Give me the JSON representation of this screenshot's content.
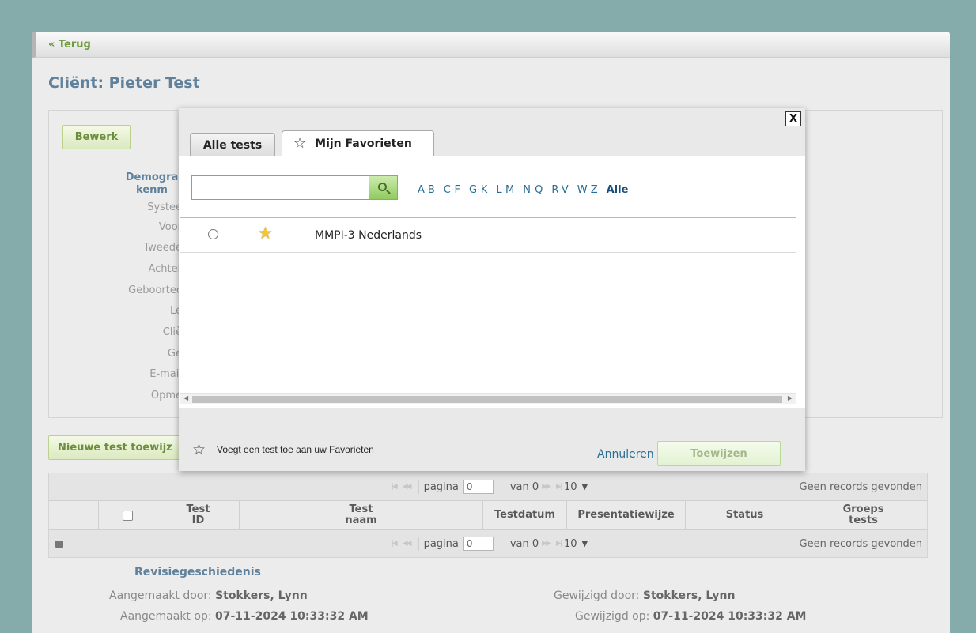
{
  "nav": {
    "back_label": "« Terug"
  },
  "client": {
    "title": "Cliënt: Pieter Test"
  },
  "panel": {
    "edit_label": "Bewerk",
    "demographics_heading": "Demogra\nkenm",
    "field_labels": [
      "Systee",
      "Voor",
      "Tweede",
      "Achter",
      "Geboortec",
      "Le",
      "Cliè",
      "Ge",
      "E-mail",
      "Opme"
    ]
  },
  "assign": {
    "new_test_label": "Nieuwe test toewijz"
  },
  "grid": {
    "pager": {
      "page_label": "pagina",
      "page_value": "0",
      "of_label": "van 0",
      "rows_per_page": "10",
      "no_records": "Geen records gevonden"
    },
    "columns": [
      "Test\nID",
      "Test\nnaam",
      "Testdatum",
      "Presentatiewijze",
      "Status",
      "Groeps\ntests"
    ]
  },
  "revision": {
    "title": "Revisiegeschiedenis",
    "created_by_label": "Aangemaakt door:",
    "created_by": "Stokkers, Lynn",
    "created_on_label": "Aangemaakt op:",
    "created_on": "07-11-2024 10:33:32 AM",
    "modified_by_label": "Gewijzigd door:",
    "modified_by": "Stokkers, Lynn",
    "modified_on_label": "Gewijzigd op:",
    "modified_on": "07-11-2024 10:33:32 AM"
  },
  "modal": {
    "close_label": "X",
    "tabs": {
      "all": "Alle tests",
      "favorites": "Mijn Favorieten"
    },
    "search": {
      "value": "",
      "placeholder": ""
    },
    "alpha_filters": [
      "A-B",
      "C-F",
      "G-K",
      "L-M",
      "N-Q",
      "R-V",
      "W-Z",
      "Alle"
    ],
    "active_filter": "Alle",
    "tests": [
      {
        "name": "MMPI-3 Nederlands",
        "favorite": true,
        "selected": false
      }
    ],
    "footer_note": "Voegt een test toe aan uw Favorieten",
    "cancel_label": "Annuleren",
    "assign_label": "Toewijzen"
  },
  "icons": {
    "star_outline": "star-outline-icon",
    "star_filled": "star-filled-icon",
    "search": "search-icon",
    "close": "close-icon"
  },
  "colors": {
    "background": "#86abab",
    "accent_blue": "#5f819c",
    "link_blue": "#2a6d94",
    "green_button": "#dbe9bf",
    "star_gold": "#f3c53a"
  }
}
